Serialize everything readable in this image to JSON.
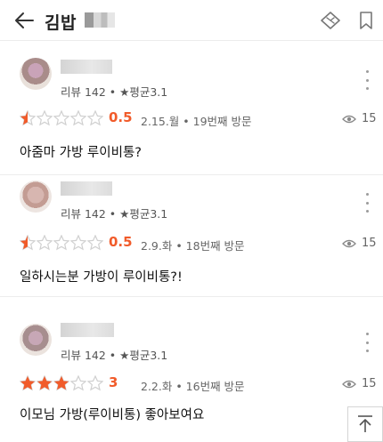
{
  "header": {
    "title": "김밥",
    "back_icon": "back-arrow-icon",
    "tag_icon": "tag-icon",
    "bookmark_icon": "bookmark-icon"
  },
  "colors": {
    "accent": "#f15b2a",
    "star_empty": "#d0d0d0",
    "divider": "#ececec"
  },
  "reviews": [
    {
      "meta": "리뷰 142 • ★평균3.1",
      "rating": 0.5,
      "score": "0.5",
      "visit": "2.15.월 • 19번째 방문",
      "views": "15",
      "comment": "아줌마 가방 루이비통?"
    },
    {
      "meta": "리뷰 142 • ★평균3.1",
      "rating": 0.5,
      "score": "0.5",
      "visit": "2.9.화 • 18번째 방문",
      "views": "15",
      "comment": "일하시는분 가방이 루이비통?!"
    },
    {
      "meta": "리뷰 142 • ★평균3.1",
      "rating": 3,
      "score": "3",
      "visit": "2.2.화 • 16번째 방문",
      "views": "15",
      "comment": "이모님 가방(루이비통) 좋아보여요"
    }
  ],
  "scroll_top_icon": "scroll-to-top-icon"
}
